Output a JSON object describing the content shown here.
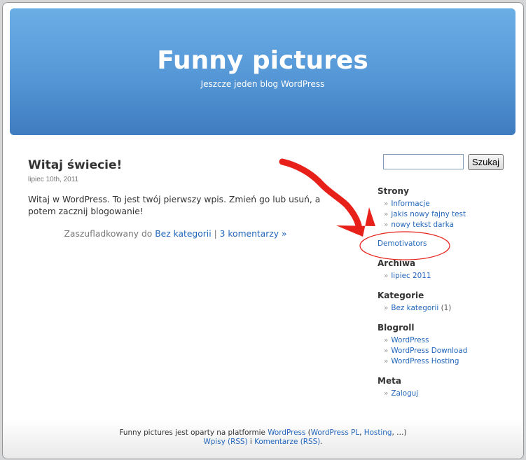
{
  "header": {
    "title": "Funny pictures",
    "description": "Jeszcze jeden blog WordPress"
  },
  "post": {
    "title": "Witaj świecie!",
    "date": "lipiec 10th, 2011",
    "content_line1": "Witaj w WordPress. To jest twój pierwszy wpis. Zmień go lub usuń, a",
    "content_line2": "potem zacznij blogowanie!",
    "meta_prefix": "Zaszufladkowany do",
    "category": "Bez kategorii",
    "separator": "|",
    "comments": "3 komentarzy »"
  },
  "search": {
    "value": "",
    "button": "Szukaj"
  },
  "sidebar": {
    "raquo": "»",
    "pages": {
      "heading": "Strony",
      "items": [
        "Informacje",
        "jakis nowy fajny test",
        "nowy tekst darka"
      ]
    },
    "highlight_link": "Demotivators",
    "archives": {
      "heading": "Archiwa",
      "items": [
        "lipiec 2011"
      ]
    },
    "categories": {
      "heading": "Kategorie",
      "item": "Bez kategorii",
      "count": "(1)"
    },
    "blogroll": {
      "heading": "Blogroll",
      "items": [
        "WordPress",
        "WordPress Download",
        "WordPress Hosting"
      ]
    },
    "meta": {
      "heading": "Meta",
      "items": [
        "Zaloguj"
      ]
    }
  },
  "footer": {
    "text1": "Funny pictures jest oparty na platformie",
    "wp": "WordPress",
    "open": "(",
    "wp_pl": "WordPress PL",
    "comma": ",",
    "hosting": "Hosting",
    "ellipsis": ", …)",
    "posts_rss": "Wpisy (RSS)",
    "and": "i",
    "comments_rss": "Komentarze (RSS)",
    "dot": "."
  },
  "annotation": {
    "color": "#e8201a"
  }
}
